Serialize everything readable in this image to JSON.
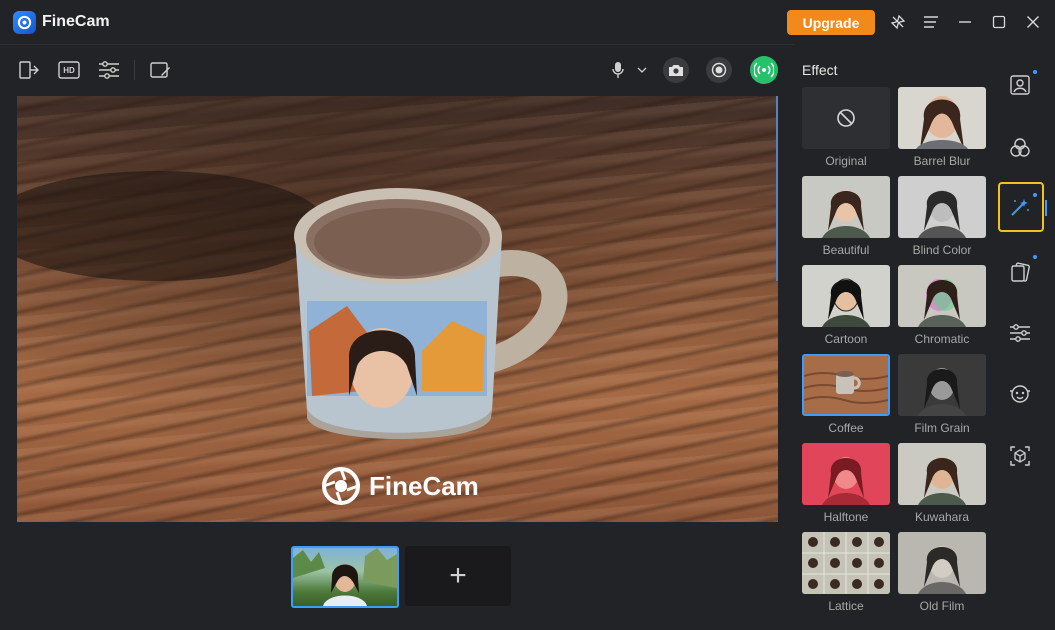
{
  "app": {
    "name": "FineCam"
  },
  "titlebar": {
    "upgrade_label": "Upgrade"
  },
  "toolbar": {
    "hd_label": "HD"
  },
  "preview": {
    "watermark": "FineCam"
  },
  "bottom": {
    "add_label": "+"
  },
  "effects": {
    "title": "Effect",
    "items": [
      {
        "label": "Original"
      },
      {
        "label": "Barrel Blur"
      },
      {
        "label": "Beautiful"
      },
      {
        "label": "Blind Color"
      },
      {
        "label": "Cartoon"
      },
      {
        "label": "Chromatic"
      },
      {
        "label": "Coffee",
        "selected": true
      },
      {
        "label": "Film Grain"
      },
      {
        "label": "Halftone"
      },
      {
        "label": "Kuwahara"
      },
      {
        "label": "Lattice"
      },
      {
        "label": "Old Film"
      }
    ]
  },
  "colors": {
    "accent": "#3c9dff",
    "upgrade": "#f28a1b",
    "live": "#26c26b",
    "rail_active": "#f2c21b"
  }
}
